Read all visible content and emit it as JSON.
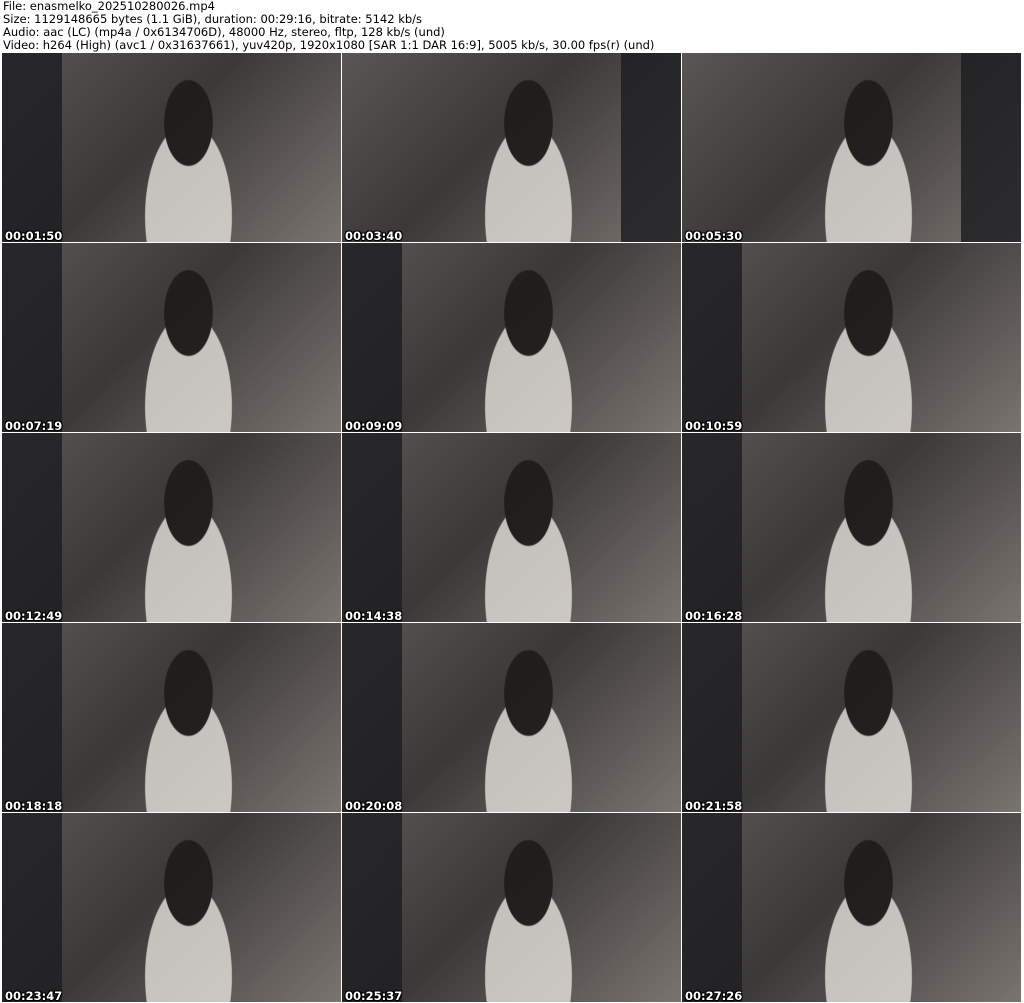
{
  "header": {
    "file": "File: enasmelko_202510280026.mp4",
    "size": "Size: 1129148665 bytes (1.1 GiB), duration: 00:29:16, bitrate: 5142 kb/s",
    "audio": "Audio: aac (LC) (mp4a / 0x6134706D), 48000 Hz, stereo, fltp, 128 kb/s (und)",
    "video": "Video: h264 (High) (avc1 / 0x31637661), yuv420p, 1920x1080 [SAR 1:1 DAR 16:9], 5005 kb/s, 30.00 fps(r) (und)"
  },
  "thumbnails": [
    {
      "timestamp": "00:01:50"
    },
    {
      "timestamp": "00:03:40"
    },
    {
      "timestamp": "00:05:30"
    },
    {
      "timestamp": "00:07:19"
    },
    {
      "timestamp": "00:09:09"
    },
    {
      "timestamp": "00:10:59"
    },
    {
      "timestamp": "00:12:49"
    },
    {
      "timestamp": "00:14:38"
    },
    {
      "timestamp": "00:16:28"
    },
    {
      "timestamp": "00:18:18"
    },
    {
      "timestamp": "00:20:08"
    },
    {
      "timestamp": "00:21:58"
    },
    {
      "timestamp": "00:23:47"
    },
    {
      "timestamp": "00:25:37"
    },
    {
      "timestamp": "00:27:26"
    }
  ]
}
